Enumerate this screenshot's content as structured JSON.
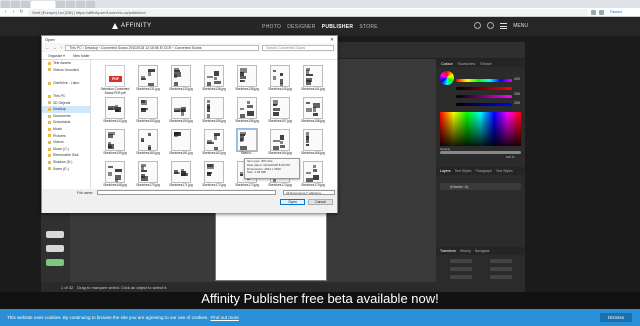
{
  "browser": {
    "url": "https://affinity.serif.com/en-us/publisher/",
    "site_label": "Serif (Europe) Ltd [GB]",
    "extension_label": "Paused"
  },
  "site": {
    "logo_text": "AFFINITY",
    "nav": [
      "PHOTO",
      "DESIGNER",
      "PUBLISHER",
      "STORE"
    ],
    "active_nav": "PUBLISHER",
    "menu_label": "MENU"
  },
  "app": {
    "panel_tabs": [
      "Colour",
      "Swatches",
      "Stroke"
    ],
    "color_values": [
      "400",
      "255",
      "255"
    ],
    "opacity_label": "Opacity",
    "opacity_value": "100 %",
    "layers_tabs": [
      "Layers",
      "Text Styles",
      "Paragraph",
      "Text Styles"
    ],
    "layer_name": "(Master A)",
    "transform_tabs": [
      "Transform",
      "History",
      "Navigator"
    ],
    "page_counter": "1 of 32",
    "status_text": "Drag to marquee select. Click an object to select it."
  },
  "dialog": {
    "title": "Open",
    "path": "This PC  ›  Desktop  ›  Converted Scans 29102018 12:15:56 Ei OCR  ›  Converted Scans",
    "search_placeholder": "Search Converted Scans",
    "organize": "Organize ▾",
    "new_folder": "New folder",
    "nav_items": [
      "Tele Assets",
      "Videos Unsorted",
      "",
      "OneDrive - Lisbo",
      "",
      "This PC",
      "3D Objects",
      "Desktop",
      "Documents",
      "Downloads",
      "Music",
      "Pictures",
      "Videos",
      "Music (C:)",
      "Removable Disk",
      "Shadow (D:)",
      "Some (E:)"
    ],
    "selected_nav": "Desktop",
    "files": [
      "Selection Converted Scans PDF.pdf",
      "Sketches131.jpg",
      "Sketches133.jpg",
      "Sketches136.jpg",
      "Sketches138.jpg",
      "Sketches140.jpg",
      "Sketches141.jpg",
      "Sketches142.jpg",
      "Sketches153.jpg",
      "Sketches154.jpg",
      "Sketches155.jpg",
      "Sketches156.jpg",
      "Sketches157.jpg",
      "Sketches158.jpg",
      "Sketches159.jpg",
      "Sketches160.jpg",
      "Sketches161.jpg",
      "Sketches162.jpg",
      "Sketch...",
      "Sketches164.jpg",
      "Sketches165.jpg",
      "Sketches168.jpg",
      "Sketches170.jpg",
      "Sketches171.jpg",
      "Sketches172.jpg",
      "Sketches173.jpg",
      "Sketches174.jpg",
      "Sketches175.jpg"
    ],
    "tooltip": [
      "Item type: JPG File",
      "Date taken: 11/10/2018 8:45 PM",
      "Dimensions: 2544 x 3540",
      "Size: 1.66 MB"
    ],
    "filename_label": "File name:",
    "file_type": "All Documents (*.afdesign;...",
    "open_label": "Open",
    "cancel_label": "Cancel"
  },
  "banner_text": "Affinity Publisher free beta available now!",
  "cookie": {
    "text": "This website uses cookies. By continuing to browse the site you are agreeing to our use of cookies.",
    "link": "Find out more",
    "dismiss": "Dismiss"
  },
  "colors": {
    "cookie_bar": "#2a8fd4",
    "header": "#262626",
    "banner": "#111111",
    "dialog_selected": "#cce8ff"
  }
}
